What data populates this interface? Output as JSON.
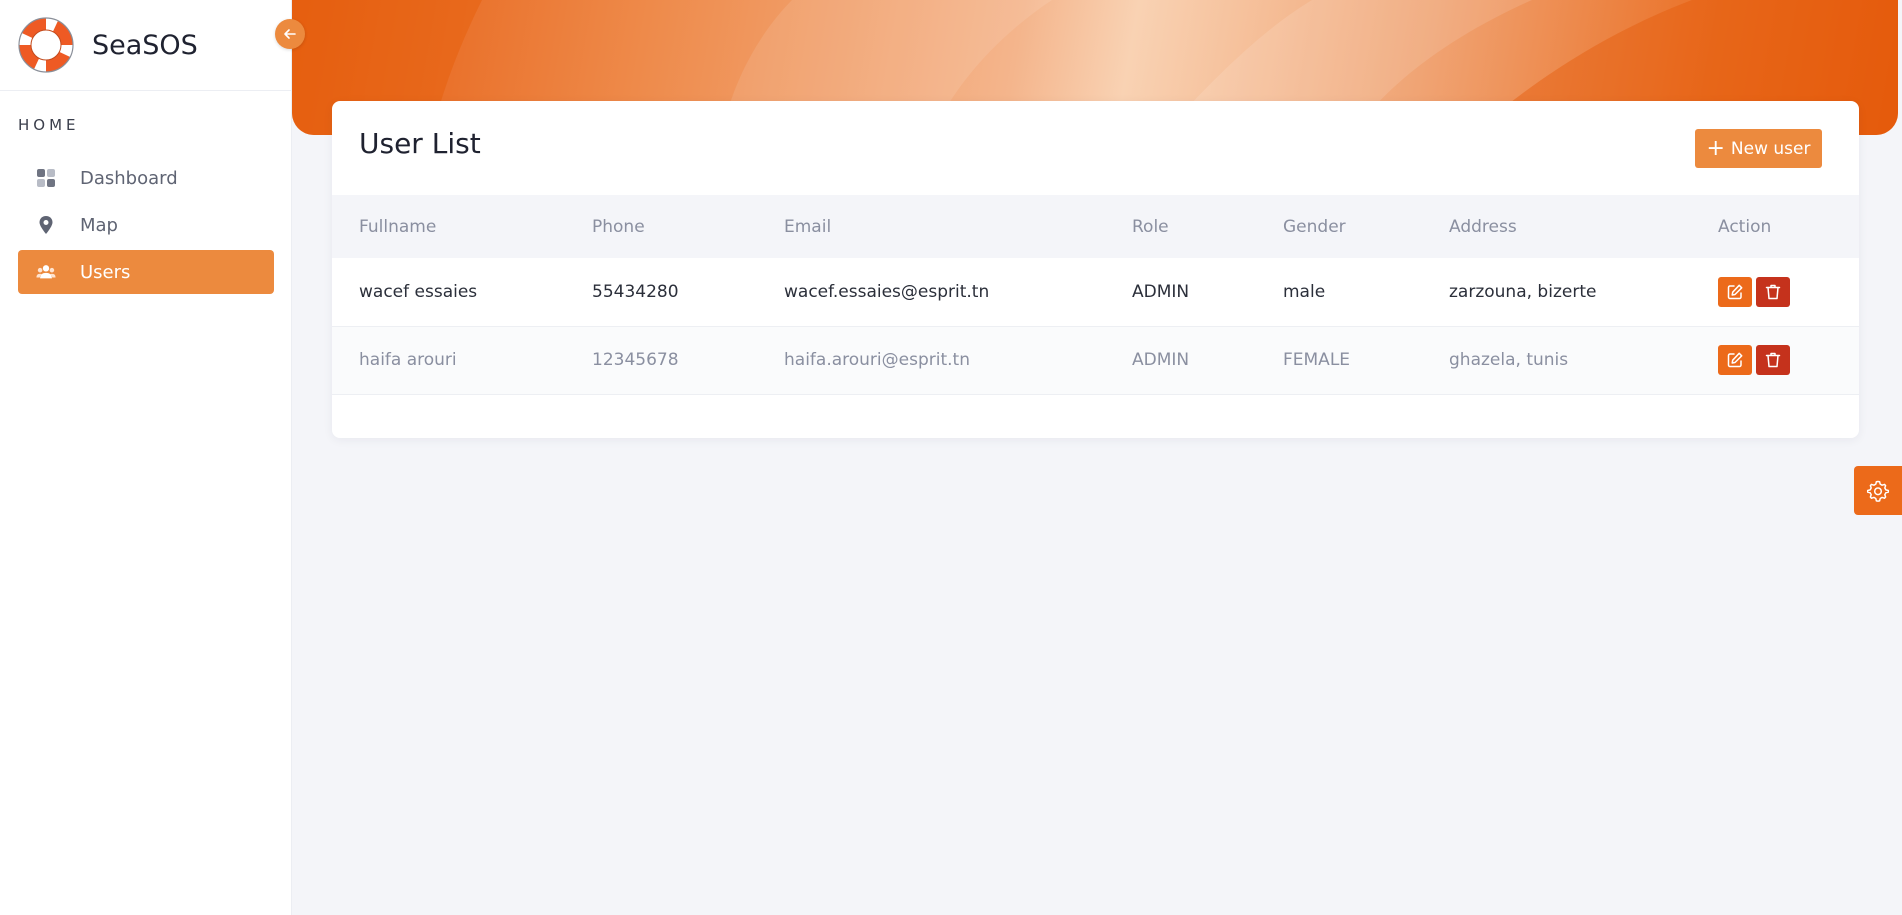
{
  "brand": {
    "name": "SeaSOS"
  },
  "sidebar": {
    "section_label": "HOME",
    "items": [
      {
        "label": "Dashboard",
        "icon": "grid-icon"
      },
      {
        "label": "Map",
        "icon": "map-pin-icon"
      },
      {
        "label": "Users",
        "icon": "users-icon",
        "active": true
      }
    ]
  },
  "card": {
    "title": "User List",
    "new_user_label": "New user"
  },
  "table": {
    "headers": [
      "Fullname",
      "Phone",
      "Email",
      "Role",
      "Gender",
      "Address",
      "Action"
    ],
    "rows": [
      {
        "fullname": "wacef essaies",
        "phone": "55434280",
        "email": "wacef.essaies@esprit.tn",
        "role": "ADMIN",
        "gender": "male",
        "address": "zarzouna, bizerte"
      },
      {
        "fullname": "haifa arouri",
        "phone": "12345678",
        "email": "haifa.arouri@esprit.tn",
        "role": "ADMIN",
        "gender": "FEMALE",
        "address": "ghazela, tunis"
      }
    ]
  },
  "colors": {
    "accent": "#ec8a3e",
    "edit": "#ec6a1a",
    "delete": "#c5321c",
    "background": "#f4f5f9"
  }
}
